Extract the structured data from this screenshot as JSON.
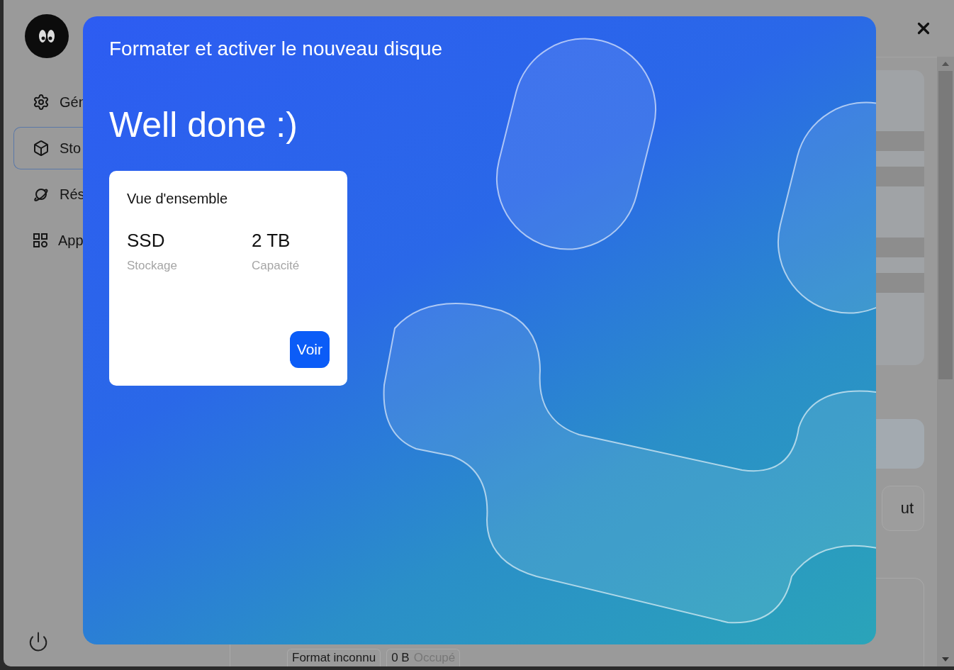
{
  "sidebar": {
    "items": [
      {
        "label": "Gén",
        "selected": false
      },
      {
        "label": "Sto",
        "selected": true
      },
      {
        "label": "Rés",
        "selected": false
      },
      {
        "label": "App",
        "selected": false
      }
    ]
  },
  "background": {
    "button": "ut",
    "chips": [
      {
        "value": "Format inconnu"
      },
      {
        "value": "0 B",
        "label": "Occupé"
      }
    ]
  },
  "modal": {
    "title": "Formater et activer le nouveau disque",
    "heading": "Well done :)",
    "card": {
      "title": "Vue d'ensemble",
      "stats": [
        {
          "value": "SSD",
          "label": "Stockage"
        },
        {
          "value": "2 TB",
          "label": "Capacité"
        }
      ],
      "button": "Voir"
    }
  }
}
